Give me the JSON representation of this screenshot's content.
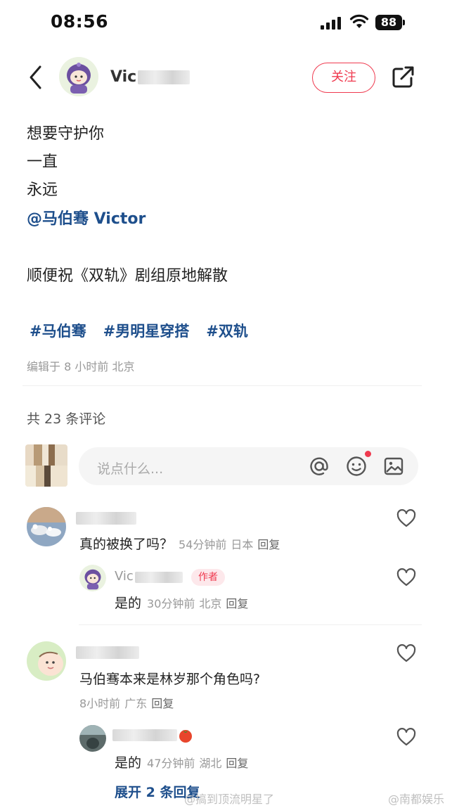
{
  "status_bar": {
    "time": "08:56",
    "battery": "88"
  },
  "header": {
    "author_name": "Vic",
    "follow_label": "关注"
  },
  "post": {
    "lines": [
      "想要守护你",
      "一直",
      "永远"
    ],
    "mention": "@马伯骞 Victor",
    "line2": "顺便祝《双轨》剧组原地解散",
    "tags": [
      "#马伯骞",
      "#男明星穿搭",
      "#双轨"
    ],
    "meta": "编辑于 8 小时前 北京"
  },
  "comments_header": {
    "count_text": "共 23 条评论"
  },
  "comment_input": {
    "placeholder": "说点什么..."
  },
  "comments": [
    {
      "text": "真的被换了吗？",
      "time": "54分钟前",
      "location": "日本",
      "reply_label": "回复",
      "replies": [
        {
          "name": "Vic",
          "badge": "作者",
          "text": "是的",
          "time": "30分钟前",
          "location": "北京",
          "reply_label": "回复"
        }
      ]
    },
    {
      "text": "马伯骞本来是林岁那个角色吗?",
      "time": "8小时前",
      "location": "广东",
      "reply_label": "回复",
      "replies": [
        {
          "text": "是的",
          "time": "47分钟前",
          "location": "湖北",
          "reply_label": "回复"
        }
      ],
      "expand_label": "展开 2 条回复"
    }
  ],
  "watermarks": [
    "@搞到顶流明星了",
    "@南都娱乐"
  ],
  "colors": {
    "accent": "#ef3a4f",
    "link": "#1e4f8c",
    "muted": "#999999"
  }
}
